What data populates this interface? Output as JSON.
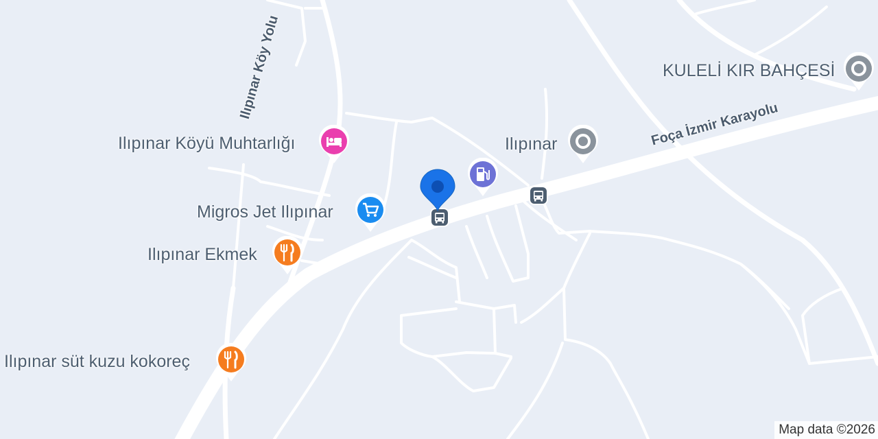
{
  "map": {
    "roads": {
      "main_road": "Foça İzmir Karayolu",
      "village_road": "Ilıpınar Köy Yolu"
    },
    "pois": [
      {
        "id": "kuleli",
        "label": "KULELİ KIR BAHÇESİ",
        "icon": "place-marker-icon",
        "color": "#8a939c"
      },
      {
        "id": "ilipinar",
        "label": "Ilıpınar",
        "icon": "place-marker-icon",
        "color": "#8a939c"
      },
      {
        "id": "muhtarlik",
        "label": "Ilıpınar Köyü Muhtarlığı",
        "icon": "lodging-icon",
        "color": "#ea3fae"
      },
      {
        "id": "fuel",
        "label": "",
        "icon": "fuel-pump-icon",
        "color": "#6d72d6"
      },
      {
        "id": "migros",
        "label": "Migros Jet Ilıpınar",
        "icon": "shopping-cart-icon",
        "color": "#1a8cf0"
      },
      {
        "id": "ekmek",
        "label": "Ilıpınar Ekmek",
        "icon": "fork-knife-icon",
        "color": "#f57c1f"
      },
      {
        "id": "kokorec",
        "label": "Ilıpınar süt kuzu kokoreç",
        "icon": "fork-knife-icon",
        "color": "#f57c1f"
      }
    ],
    "transit_stops": [
      {
        "id": "bus-stop-east",
        "icon": "bus-icon",
        "color": "#4d5e70"
      },
      {
        "id": "bus-stop-west",
        "icon": "bus-icon",
        "color": "#4d5e70"
      }
    ],
    "selected_marker": {
      "icon": "location-pin-icon",
      "color": "#1a73e8"
    },
    "attribution": "Map data ©2026"
  }
}
